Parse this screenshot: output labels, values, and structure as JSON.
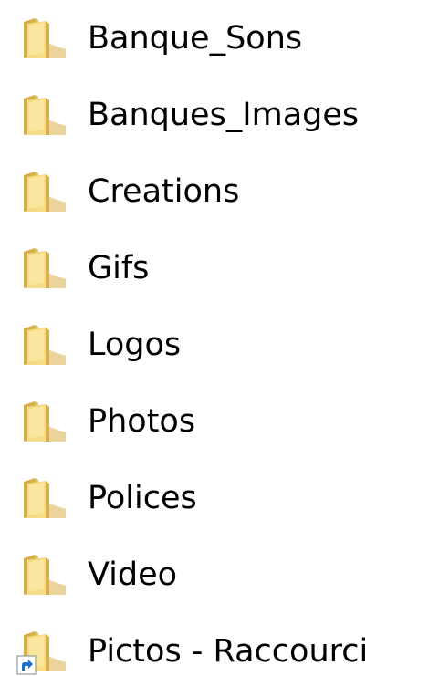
{
  "colors": {
    "folder_back": "#d8b04a",
    "folder_front": "#f6dc86",
    "folder_highlight": "#fff3bf",
    "shortcut_arrow_bg": "#ffffff",
    "shortcut_arrow": "#1a6fd1",
    "text": "#000000",
    "background": "#ffffff"
  },
  "items": [
    {
      "label": "Banque_Sons",
      "type": "folder",
      "icon": "folder-icon"
    },
    {
      "label": "Banques_Images",
      "type": "folder",
      "icon": "folder-icon"
    },
    {
      "label": "Creations",
      "type": "folder",
      "icon": "folder-icon"
    },
    {
      "label": "Gifs",
      "type": "folder",
      "icon": "folder-icon"
    },
    {
      "label": "Logos",
      "type": "folder",
      "icon": "folder-icon"
    },
    {
      "label": "Photos",
      "type": "folder",
      "icon": "folder-icon"
    },
    {
      "label": "Polices",
      "type": "folder",
      "icon": "folder-icon"
    },
    {
      "label": "Video",
      "type": "folder",
      "icon": "folder-icon"
    },
    {
      "label": "Pictos - Raccourci",
      "type": "shortcut",
      "icon": "folder-shortcut-icon"
    }
  ]
}
